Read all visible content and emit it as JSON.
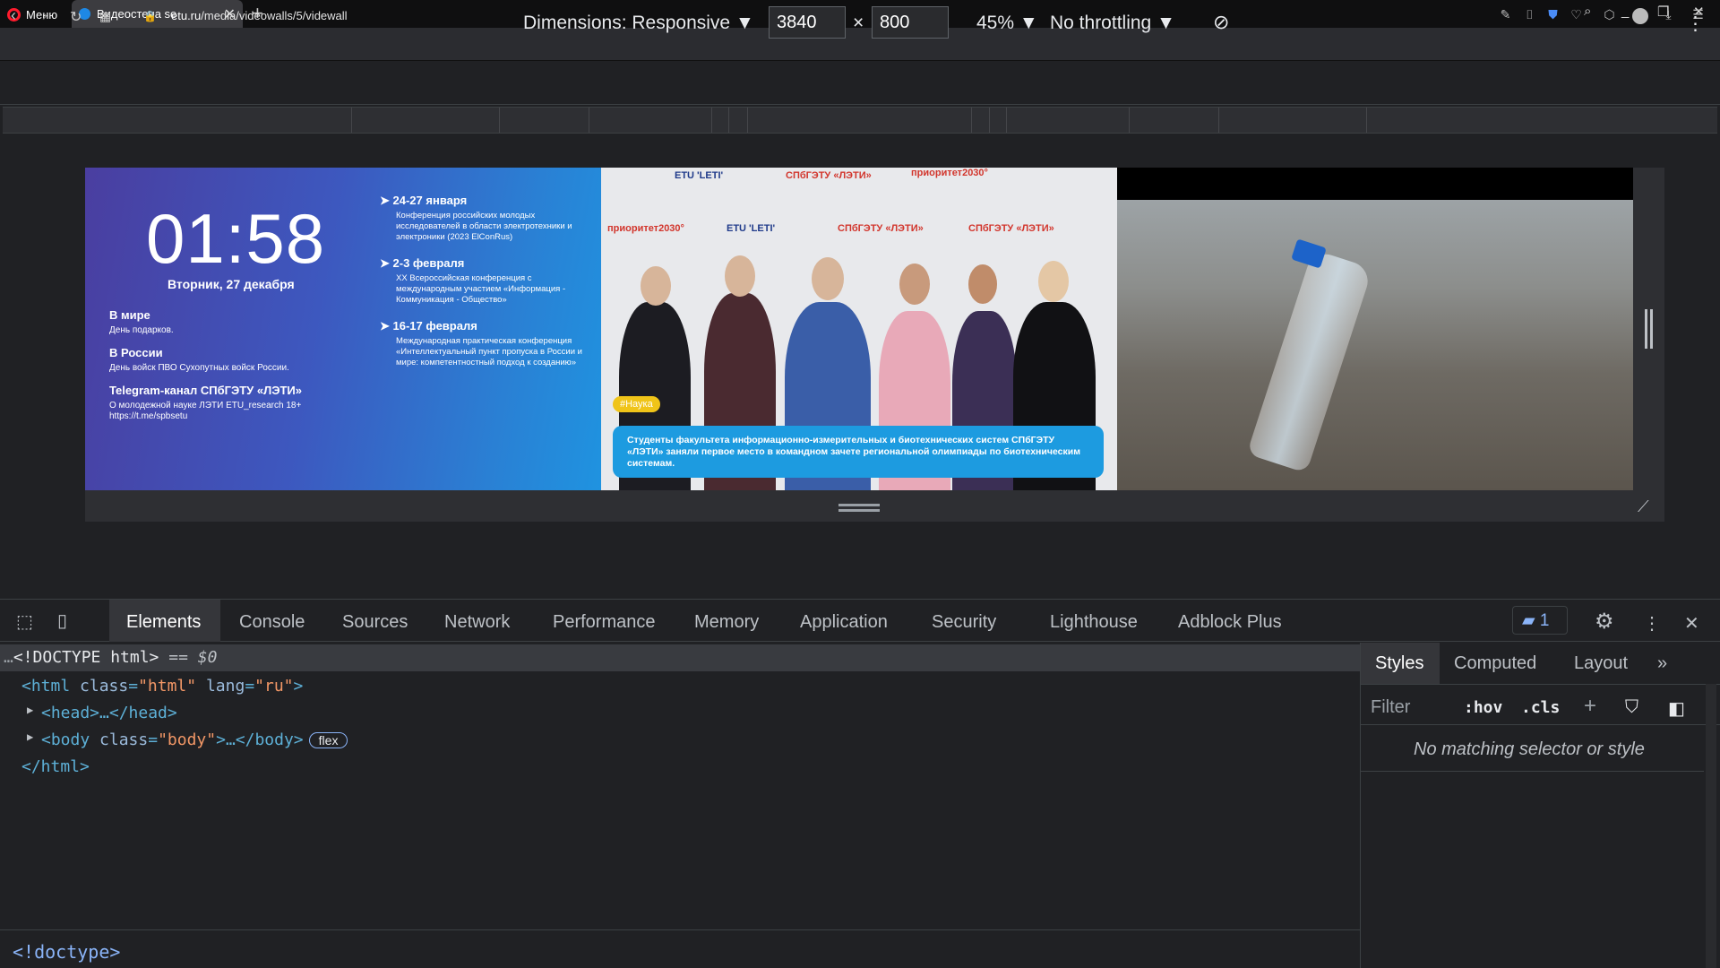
{
  "browser": {
    "menu_label": "Меню",
    "tab_title": "Видеостена se",
    "url_host": "etu.ru",
    "url_path": "/media/videowalls/5/videwall"
  },
  "device_toolbar": {
    "dimensions_label": "Dimensions: Responsive",
    "width_value": "3840",
    "times_sign": "×",
    "height_value": "800",
    "zoom": "45%",
    "throttling": "No throttling"
  },
  "videowall": {
    "clock": "01:58",
    "date": "Вторник, 27 декабря",
    "world_heading": "В мире",
    "world_text": "День подарков.",
    "russia_heading": "В России",
    "russia_text": "День войск ПВО Сухопутных войск России.",
    "telegram_heading": "Telegram-канал СПбГЭТУ «ЛЭТИ»",
    "telegram_text": "О молодежной науке ЛЭТИ ETU_research 18+",
    "telegram_link": "https://t.me/spbsetu",
    "events": [
      {
        "date": "24-27 января",
        "desc": "Конференция российских молодых исследователей в области электротехники и электроники (2023 ElConRus)"
      },
      {
        "date": "2-3 февраля",
        "desc": "XX Всероссийская конференция с международным участием «Информация - Коммуникация - Общество»"
      },
      {
        "date": "16-17 февраля",
        "desc": "Международная практическая конференция «Интеллектуальный пункт пропуска в России и мире: компетентностный подход к созданию»"
      }
    ],
    "photo_badge": "#Наука",
    "photo_caption": "Студенты факультета информационно-измерительных и биотехнических систем СПбГЭТУ «ЛЭТИ» заняли первое место в командном зачете региональной олимпиады по биотехническим системам.",
    "logo_etu": "ETU 'LETI'",
    "logo_spb": "СПбГЭТУ «ЛЭТИ»",
    "logo_priority": "приоритет2030°"
  },
  "devtools": {
    "tabs": [
      "Elements",
      "Console",
      "Sources",
      "Network",
      "Performance",
      "Memory",
      "Application",
      "Security",
      "Lighthouse",
      "Adblock Plus"
    ],
    "message_count": "1",
    "dom": {
      "doctype": "<!DOCTYPE html>",
      "doctype_suffix": " == $0",
      "html_open_tag": "html",
      "html_class_attr": "class",
      "html_class_val": "\"html\"",
      "html_lang_attr": "lang",
      "html_lang_val": "\"ru\"",
      "head_line": "<head>…</head>",
      "body_tag": "body",
      "body_class_val": "\"body\"",
      "body_rest": ">…</body>",
      "flex_badge": "flex",
      "html_close": "</html>"
    },
    "side_tabs": [
      "Styles",
      "Computed",
      "Layout"
    ],
    "filter_placeholder": "Filter",
    "hov": ":hov",
    "cls": ".cls",
    "no_match": "No matching selector or style",
    "breadcrumb": "<!doctype>"
  }
}
